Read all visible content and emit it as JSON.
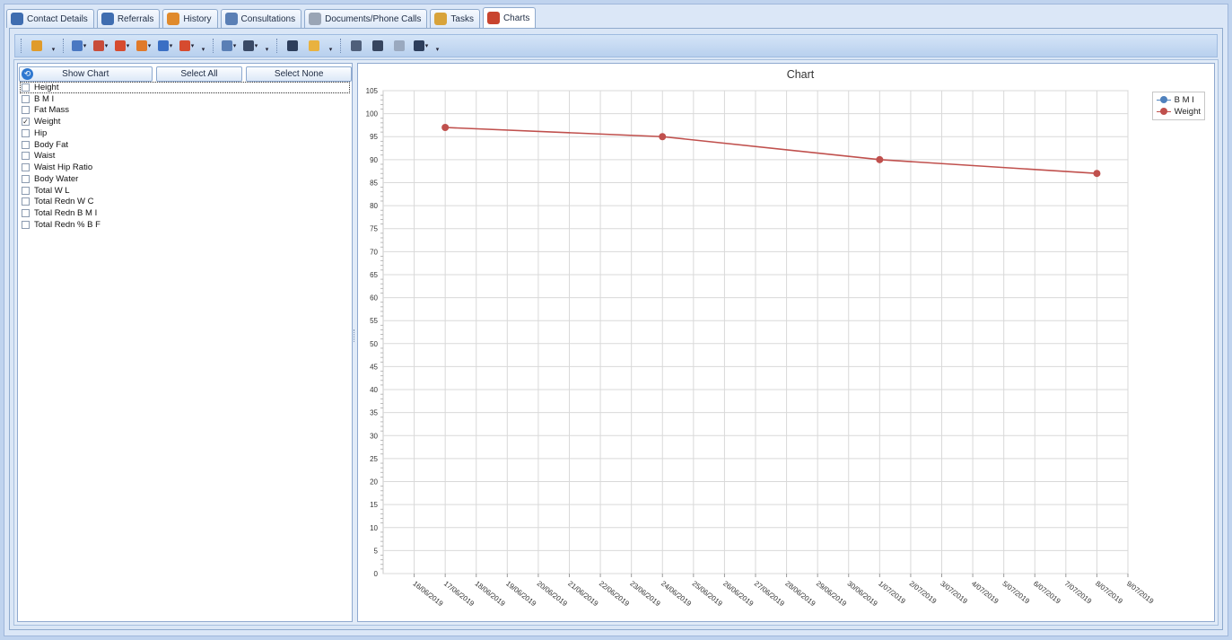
{
  "tabs": [
    {
      "label": "Contact Details",
      "icon": "contact-icon",
      "color": "#3f6db0"
    },
    {
      "label": "Referrals",
      "icon": "referrals-icon",
      "color": "#3f6db0"
    },
    {
      "label": "History",
      "icon": "history-icon",
      "color": "#e08a2c"
    },
    {
      "label": "Consultations",
      "icon": "consultations-icon",
      "color": "#5a7fb5"
    },
    {
      "label": "Documents/Phone Calls",
      "icon": "document-icon",
      "color": "#9aa5b5"
    },
    {
      "label": "Tasks",
      "icon": "tasks-icon",
      "color": "#d8a33a"
    },
    {
      "label": "Charts",
      "icon": "charts-icon",
      "color": "#c8442e"
    }
  ],
  "active_tab": "Charts",
  "toolbar": {
    "groups": [
      [
        {
          "icon": "zoom-icon",
          "color": "#e09b2a"
        }
      ],
      [
        {
          "icon": "bar-chart-icon",
          "color": "#4a78c2",
          "dropdown": true
        },
        {
          "icon": "scatter-chart-icon",
          "color": "#c84c3a",
          "dropdown": true
        },
        {
          "icon": "pie-chart-icon",
          "color": "#d64b2f",
          "dropdown": true
        },
        {
          "icon": "gantt-chart-icon",
          "color": "#e07a2a",
          "dropdown": true
        },
        {
          "icon": "area-chart-icon",
          "color": "#3a6fc4",
          "dropdown": true
        },
        {
          "icon": "doughnut-chart-icon",
          "color": "#d64b2f",
          "dropdown": true
        }
      ],
      [
        {
          "icon": "palette-icon",
          "color": "#5a7fb5",
          "dropdown": true
        },
        {
          "icon": "appearance-icon",
          "color": "#3a4a66",
          "dropdown": true
        }
      ],
      [
        {
          "icon": "save-icon",
          "color": "#2d3e5c"
        },
        {
          "icon": "open-folder-icon",
          "color": "#e9b23f"
        }
      ],
      [
        {
          "icon": "print-preview-icon",
          "color": "#4f5f7a"
        },
        {
          "icon": "print-icon",
          "color": "#36455f"
        },
        {
          "icon": "copy-icon",
          "color": "#9aa9bf"
        },
        {
          "icon": "export-icon",
          "color": "#2d3e5c",
          "dropdown": true
        }
      ]
    ]
  },
  "left_panel": {
    "show_chart_label": "Show Chart",
    "select_all_label": "Select All",
    "select_none_label": "Select None",
    "items": [
      {
        "label": "Height",
        "checked": false,
        "focused": true
      },
      {
        "label": "B M I",
        "checked": false
      },
      {
        "label": "Fat  Mass",
        "checked": false
      },
      {
        "label": "Weight",
        "checked": true
      },
      {
        "label": "Hip",
        "checked": false
      },
      {
        "label": "Body  Fat",
        "checked": false
      },
      {
        "label": "Waist",
        "checked": false
      },
      {
        "label": "Waist  Hip  Ratio",
        "checked": false
      },
      {
        "label": "Body  Water",
        "checked": false
      },
      {
        "label": "Total  W L",
        "checked": false
      },
      {
        "label": "Total  Redn  W C",
        "checked": false
      },
      {
        "label": "Total  Redn  B M I",
        "checked": false
      },
      {
        "label": "Total  Redn  % B F",
        "checked": false
      }
    ]
  },
  "chart_data": {
    "type": "line",
    "title": "Chart",
    "xlabel": "",
    "ylabel": "",
    "x_ticks": [
      "16/06/2019",
      "17/06/2019",
      "18/06/2019",
      "19/06/2019",
      "20/06/2019",
      "21/06/2019",
      "22/06/2019",
      "23/06/2019",
      "24/06/2019",
      "25/06/2019",
      "26/06/2019",
      "27/06/2019",
      "28/06/2019",
      "29/06/2019",
      "30/06/2019",
      "1/07/2019",
      "2/07/2019",
      "3/07/2019",
      "4/07/2019",
      "5/07/2019",
      "6/07/2019",
      "7/07/2019",
      "8/07/2019",
      "9/07/2019"
    ],
    "y_ticks": [
      "0",
      "5",
      "10",
      "15",
      "20",
      "25",
      "30",
      "35",
      "40",
      "45",
      "50",
      "55",
      "60",
      "65",
      "70",
      "75",
      "80",
      "85",
      "90",
      "95",
      "100",
      "105"
    ],
    "ylim": [
      0,
      105
    ],
    "xlim": [
      "15/06/2019",
      "9/07/2019"
    ],
    "grid": true,
    "legend_position": "top-right",
    "series": [
      {
        "name": "B M I",
        "color": "#4f81bd",
        "x": [],
        "y": []
      },
      {
        "name": "Weight",
        "color": "#c0504d",
        "x": [
          "17/06/2019",
          "24/06/2019",
          "1/07/2019",
          "8/07/2019"
        ],
        "y": [
          97,
          95,
          90,
          87
        ]
      }
    ]
  }
}
